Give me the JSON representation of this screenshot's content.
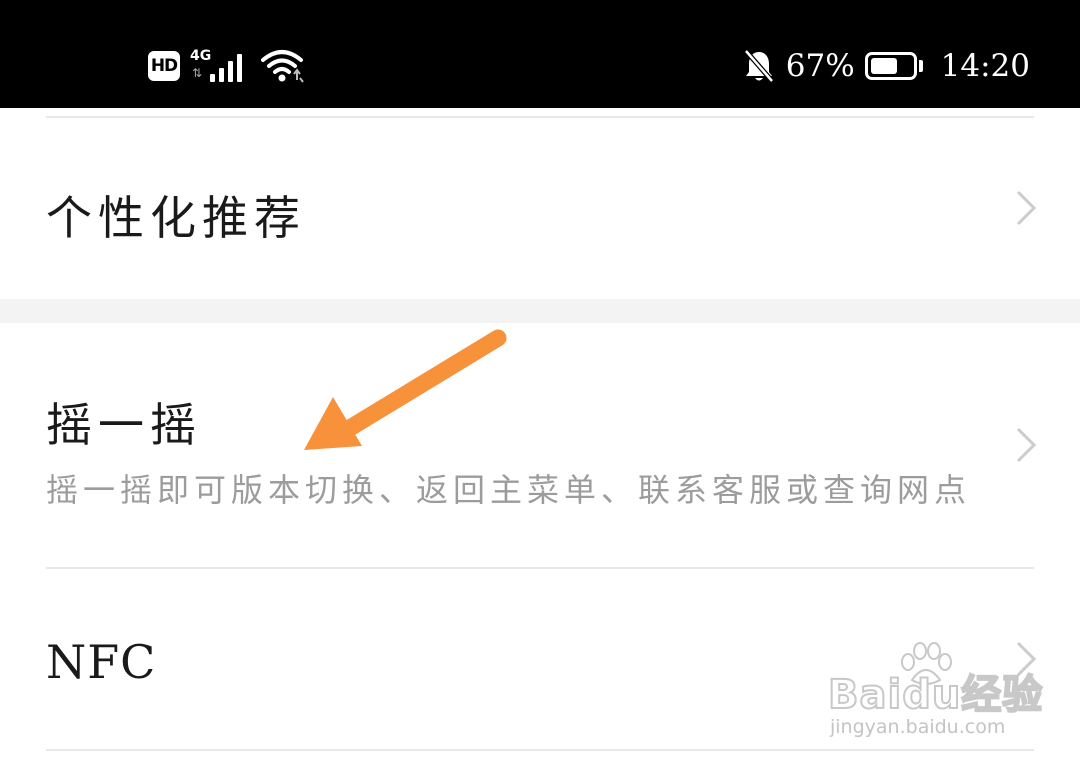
{
  "status_bar": {
    "hd_label": "HD",
    "network_type": "4G",
    "battery_percent": "67%",
    "battery_level": 0.67,
    "time": "14:20",
    "icons": [
      "hd-icon",
      "signal-icon",
      "wifi-icon",
      "bell-muted-icon",
      "battery-icon"
    ]
  },
  "settings": {
    "items": [
      {
        "title": "个性化推荐",
        "subtitle": ""
      },
      {
        "title": "摇一摇",
        "subtitle": "摇一摇即可版本切换、返回主菜单、联系客服或查询网点"
      },
      {
        "title": "NFC",
        "subtitle": ""
      }
    ]
  },
  "annotation": {
    "arrow_color": "#F7923A"
  },
  "watermark": {
    "brand": "Baidu经验",
    "url": "jingyan.baidu.com"
  },
  "colors": {
    "status_bar_bg": "#000000",
    "page_bg": "#FFFFFF",
    "divider": "#E8E8E8",
    "section_gap": "#F3F3F3",
    "title_text": "#1A1A1A",
    "subtitle_text": "#9C9C9C",
    "chevron": "#CCCCCC"
  }
}
